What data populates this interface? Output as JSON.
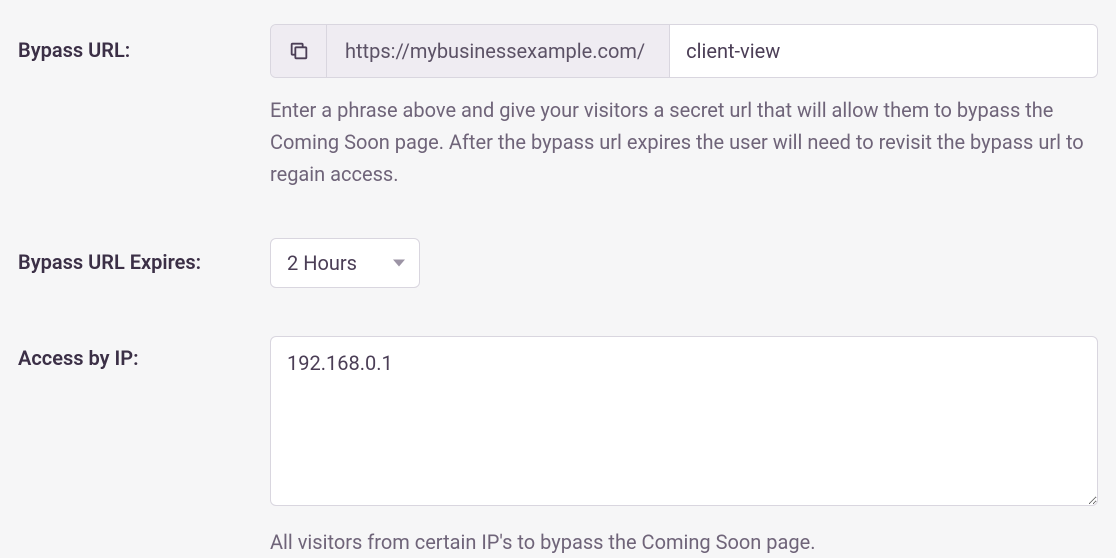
{
  "fields": {
    "bypass_url": {
      "label": "Bypass URL:",
      "prefix": "https://mybusinessexample.com/",
      "value": "client-view",
      "help": "Enter a phrase above and give your visitors a secret url that will allow them to bypass the Coming Soon page. After the bypass url expires the user will need to revisit the bypass url to regain access."
    },
    "expires": {
      "label": "Bypass URL Expires:",
      "value": "2 Hours"
    },
    "access_ip": {
      "label": "Access by IP:",
      "value": "192.168.0.1",
      "help": "All visitors from certain IP's to bypass the Coming Soon page."
    }
  }
}
